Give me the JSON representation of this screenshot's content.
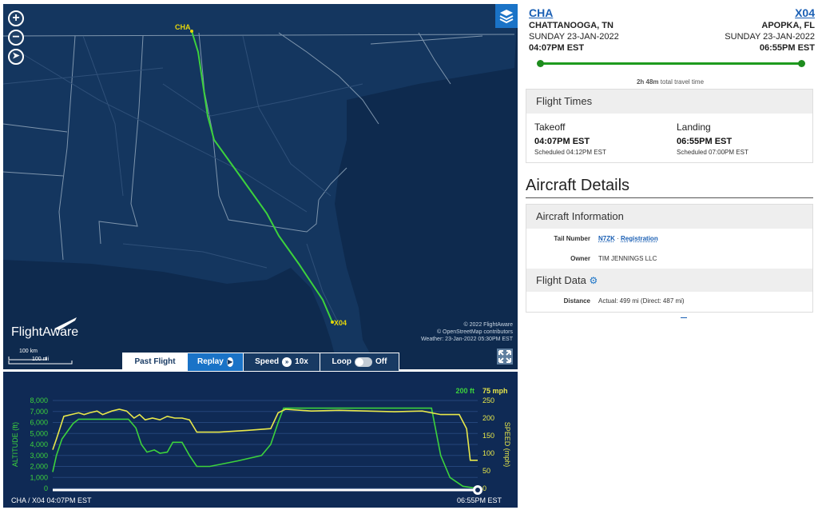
{
  "map": {
    "origin_label": "CHA",
    "dest_label": "X04",
    "logo": "FlightAware",
    "attribution": [
      "© 2022 FlightAware",
      "© OpenStreetMap contributors",
      "Weather: 23-Jan-2022 05:30PM EST"
    ],
    "scale_km": "100 km",
    "scale_mi": "100 mi",
    "icons": [
      "zoom-in-icon",
      "zoom-out-icon",
      "compass-icon",
      "layers-icon",
      "expand-icon"
    ]
  },
  "controls": {
    "past_flight": "Past Flight",
    "replay": "Replay",
    "speed_label": "Speed",
    "speed_value": "10x",
    "loop_label": "Loop",
    "loop_value": "Off"
  },
  "chart_data": {
    "type": "line",
    "xlabel_start": "CHA / X04 04:07PM EST",
    "xlabel_end": "06:55PM EST",
    "ylabel_left": "ALTITUDE (ft)",
    "ylabel_right": "SPEED (mph)",
    "right_top_left_label": "200 ft",
    "right_top_right_label": "75 mph",
    "yticks_left": [
      "0",
      "1,000",
      "2,000",
      "3,000",
      "4,000",
      "5,000",
      "6,000",
      "7,000",
      "8,000"
    ],
    "yticks_right": [
      "0",
      "50",
      "100",
      "150",
      "200",
      "250"
    ],
    "ylim_left": [
      0,
      8000
    ],
    "ylim_right": [
      0,
      250
    ],
    "x_range_min": [
      0,
      168
    ],
    "series": [
      {
        "name": "altitude",
        "color": "#3cd23c",
        "points": [
          [
            0,
            1500
          ],
          [
            2,
            3000
          ],
          [
            5,
            4500
          ],
          [
            8,
            5200
          ],
          [
            11,
            5900
          ],
          [
            14,
            6300
          ],
          [
            18,
            6300
          ],
          [
            30,
            6300
          ],
          [
            41,
            6300
          ],
          [
            45,
            5500
          ],
          [
            48,
            4000
          ],
          [
            51,
            3300
          ],
          [
            55,
            3500
          ],
          [
            58,
            3200
          ],
          [
            62,
            3300
          ],
          [
            65,
            4200
          ],
          [
            70,
            4200
          ],
          [
            74,
            3000
          ],
          [
            78,
            2000
          ],
          [
            85,
            2000
          ],
          [
            100,
            2500
          ],
          [
            113,
            3000
          ],
          [
            118,
            4000
          ],
          [
            122,
            6000
          ],
          [
            125,
            7300
          ],
          [
            130,
            7300
          ],
          [
            160,
            7300
          ],
          [
            170,
            7300
          ],
          [
            180,
            7300
          ],
          [
            198,
            7300
          ],
          [
            205,
            7300
          ],
          [
            210,
            3000
          ],
          [
            215,
            1000
          ],
          [
            222,
            200
          ],
          [
            230,
            0
          ]
        ]
      },
      {
        "name": "speed",
        "color": "#e8e84a",
        "points": [
          [
            0,
            110
          ],
          [
            2,
            140
          ],
          [
            6,
            205
          ],
          [
            10,
            210
          ],
          [
            14,
            215
          ],
          [
            17,
            210
          ],
          [
            20,
            215
          ],
          [
            24,
            220
          ],
          [
            27,
            210
          ],
          [
            32,
            220
          ],
          [
            36,
            225
          ],
          [
            40,
            220
          ],
          [
            44,
            200
          ],
          [
            47,
            210
          ],
          [
            50,
            195
          ],
          [
            54,
            200
          ],
          [
            58,
            195
          ],
          [
            62,
            205
          ],
          [
            66,
            200
          ],
          [
            70,
            200
          ],
          [
            74,
            195
          ],
          [
            78,
            160
          ],
          [
            90,
            160
          ],
          [
            105,
            165
          ],
          [
            118,
            170
          ],
          [
            122,
            215
          ],
          [
            126,
            225
          ],
          [
            140,
            220
          ],
          [
            155,
            222
          ],
          [
            170,
            220
          ],
          [
            185,
            218
          ],
          [
            200,
            220
          ],
          [
            210,
            210
          ],
          [
            220,
            210
          ],
          [
            224,
            170
          ],
          [
            226,
            80
          ],
          [
            230,
            80
          ]
        ]
      }
    ]
  },
  "origin": {
    "code": "CHA",
    "city": "CHATTANOOGA, TN",
    "date": "SUNDAY 23-JAN-2022",
    "time": "04:07PM EST"
  },
  "destination": {
    "code": "X04",
    "city": "APOPKA, FL",
    "date": "SUNDAY 23-JAN-2022",
    "time": "06:55PM EST"
  },
  "travel": {
    "duration": "2h 48m",
    "suffix": "total travel time",
    "progress": 1.0
  },
  "flight_times": {
    "title": "Flight Times",
    "takeoff_label": "Takeoff",
    "takeoff_time": "04:07PM EST",
    "takeoff_sched": "Scheduled 04:12PM EST",
    "landing_label": "Landing",
    "landing_time": "06:55PM EST",
    "landing_sched": "Scheduled 07:00PM EST"
  },
  "aircraft": {
    "title": "Aircraft Details",
    "info_title": "Aircraft Information",
    "tail_label": "Tail Number",
    "tail_value": "N7ZK",
    "tail_sep": "·",
    "registration": "Registration",
    "owner_label": "Owner",
    "owner_value": "TIM JENNINGS LLC",
    "flight_data_title": "Flight Data",
    "distance_label": "Distance",
    "distance_value": "Actual: 499 mi (Direct: 487 mi)"
  },
  "colors": {
    "map_bg": "#14365f",
    "chart_bg": "#0f2a55",
    "route": "#3cd23c",
    "airport": "#e6d60a",
    "link": "#1a5fb4",
    "accent_blue": "#1a73c7"
  }
}
